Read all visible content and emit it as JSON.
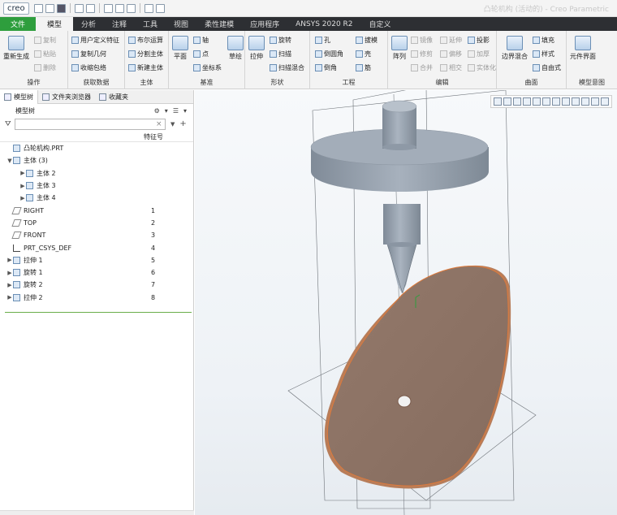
{
  "app": {
    "logo": "creo",
    "window_title": "凸轮机构 (活动的) - Creo Parametric"
  },
  "tabs": [
    {
      "label": "文件"
    },
    {
      "label": "模型"
    },
    {
      "label": "分析"
    },
    {
      "label": "注释"
    },
    {
      "label": "工具"
    },
    {
      "label": "视图"
    },
    {
      "label": "柔性建模"
    },
    {
      "label": "应用程序"
    },
    {
      "label": "ANSYS 2020 R2"
    },
    {
      "label": "自定义"
    }
  ],
  "ribbon": {
    "caozuo": {
      "label": "操作",
      "regen": "重新生成",
      "copy": "复制",
      "paste": "粘贴",
      "delete": "删除"
    },
    "huoqu": {
      "label": "获取数据",
      "udf": "用户定义特征",
      "copygeom": "复制几何",
      "shrink": "收缩包络"
    },
    "zhuti": {
      "label": "主体",
      "boolean": "布尔运算",
      "split": "分割主体",
      "newbody": "新建主体"
    },
    "jizhun": {
      "label": "基准",
      "plane": "平面",
      "axis": "轴",
      "point": "点",
      "csys": "坐标系",
      "sketch": "草绘"
    },
    "xingzhuang": {
      "label": "形状",
      "extrude": "拉伸",
      "revolve": "旋转",
      "sweep": "扫描",
      "sweepblend": "扫描混合"
    },
    "gongcheng": {
      "label": "工程",
      "hole": "孔",
      "round": "倒圆角",
      "chamfer": "倒角",
      "draft": "拔模",
      "shell": "壳",
      "rib": "筋"
    },
    "bianji": {
      "label": "编辑",
      "pattern": "阵列",
      "mirror": "镜像",
      "extend": "延伸",
      "project": "投影",
      "trim": "修剪",
      "offset": "偏移",
      "thicken": "加厚",
      "merge": "合并",
      "intersect": "相交",
      "solidify": "实体化"
    },
    "qumian": {
      "label": "曲面",
      "boundary": "边界混合",
      "fill": "填充",
      "style": "样式",
      "freeform": "自由式"
    },
    "moxing": {
      "label": "模型意图",
      "element": "元件界面"
    }
  },
  "panel": {
    "tabs": [
      "模型树",
      "文件夹浏览器",
      "收藏夹"
    ],
    "title": "模型树",
    "search_placeholder": "",
    "col_feature": "特征号",
    "tree": [
      {
        "label": "凸轮机构.PRT",
        "num": "",
        "indent": 0,
        "expander": "",
        "icon": "part"
      },
      {
        "label": "主体 (3)",
        "num": "",
        "indent": 0,
        "expander": "▼",
        "icon": "body"
      },
      {
        "label": "主体 2",
        "num": "",
        "indent": 1,
        "expander": "▶",
        "icon": "body"
      },
      {
        "label": "主体 3",
        "num": "",
        "indent": 1,
        "expander": "▶",
        "icon": "body"
      },
      {
        "label": "主体 4",
        "num": "",
        "indent": 1,
        "expander": "▶",
        "icon": "body"
      },
      {
        "label": "RIGHT",
        "num": "1",
        "indent": 0,
        "expander": "",
        "icon": "plane"
      },
      {
        "label": "TOP",
        "num": "2",
        "indent": 0,
        "expander": "",
        "icon": "plane"
      },
      {
        "label": "FRONT",
        "num": "3",
        "indent": 0,
        "expander": "",
        "icon": "plane"
      },
      {
        "label": "PRT_CSYS_DEF",
        "num": "4",
        "indent": 0,
        "expander": "",
        "icon": "csys"
      },
      {
        "label": "拉伸 1",
        "num": "5",
        "indent": 0,
        "expander": "▶",
        "icon": "body"
      },
      {
        "label": "旋转 1",
        "num": "6",
        "indent": 0,
        "expander": "▶",
        "icon": "body"
      },
      {
        "label": "旋转 2",
        "num": "7",
        "indent": 0,
        "expander": "▶",
        "icon": "body"
      },
      {
        "label": "拉伸 2",
        "num": "8",
        "indent": 0,
        "expander": "▶",
        "icon": "body"
      }
    ]
  },
  "colors": {
    "file_tab": "#2e9e3d",
    "tabbar": "#2d2f33",
    "cam": "#8d7466",
    "cam_edge": "#e07a3a",
    "follower": "#9aa5b2"
  }
}
